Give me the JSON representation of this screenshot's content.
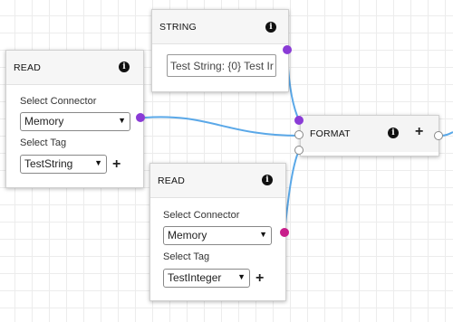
{
  "nodes": {
    "string": {
      "title": "STRING",
      "value": "Test String: {0} Test Ir"
    },
    "read1": {
      "title": "READ",
      "connector_label": "Select Connector",
      "connector_value": "Memory",
      "tag_label": "Select Tag",
      "tag_value": "TestString"
    },
    "read2": {
      "title": "READ",
      "connector_label": "Select Connector",
      "connector_value": "Memory",
      "tag_label": "Select Tag",
      "tag_value": "TestInteger"
    },
    "format": {
      "title": "FORMAT"
    }
  },
  "icons": {
    "info": "info-icon",
    "add": "plus-icon",
    "dropdown": "chevron-down-icon"
  },
  "colors": {
    "wire": "#5aa8e8",
    "port_purple": "#8a3bd6",
    "port_magenta": "#c81d8a"
  }
}
